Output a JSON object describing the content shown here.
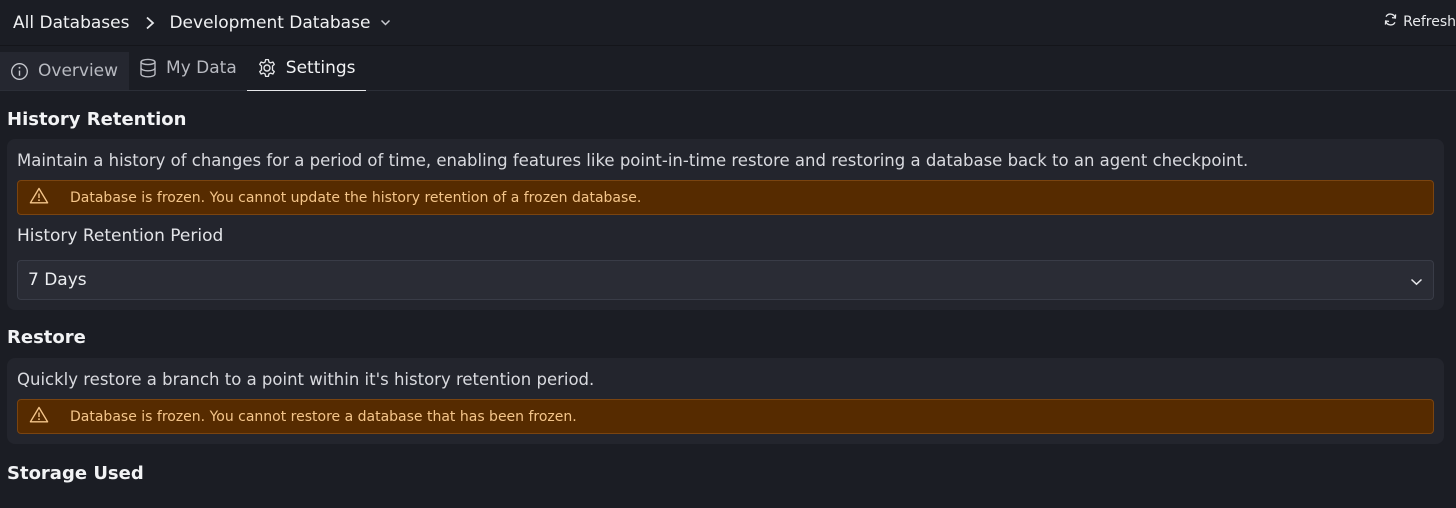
{
  "breadcrumb": {
    "root": "All Databases",
    "current": "Development Database"
  },
  "header": {
    "refresh_label": "Refresh"
  },
  "tabs": [
    {
      "label": "Overview",
      "icon": "info-circle-icon"
    },
    {
      "label": "My Data",
      "icon": "database-icon"
    },
    {
      "label": "Settings",
      "icon": "gear-icon",
      "active": true
    }
  ],
  "history_retention": {
    "title": "History Retention",
    "description": "Maintain a history of changes for a period of time, enabling features like point-in-time restore and restoring a database back to an agent checkpoint.",
    "warning": "Database is frozen. You cannot update the history retention of a frozen database.",
    "field_label": "History Retention Period",
    "selected_value": "7 Days"
  },
  "restore": {
    "title": "Restore",
    "description": "Quickly restore a branch to a point within it's history retention period.",
    "warning": "Database is frozen. You cannot restore a database that has been frozen."
  },
  "storage": {
    "title": "Storage Used"
  },
  "colors": {
    "background": "#1b1d24",
    "card": "#23252d",
    "warning_bg": "#562b00",
    "warning_text": "#f4c58a"
  }
}
